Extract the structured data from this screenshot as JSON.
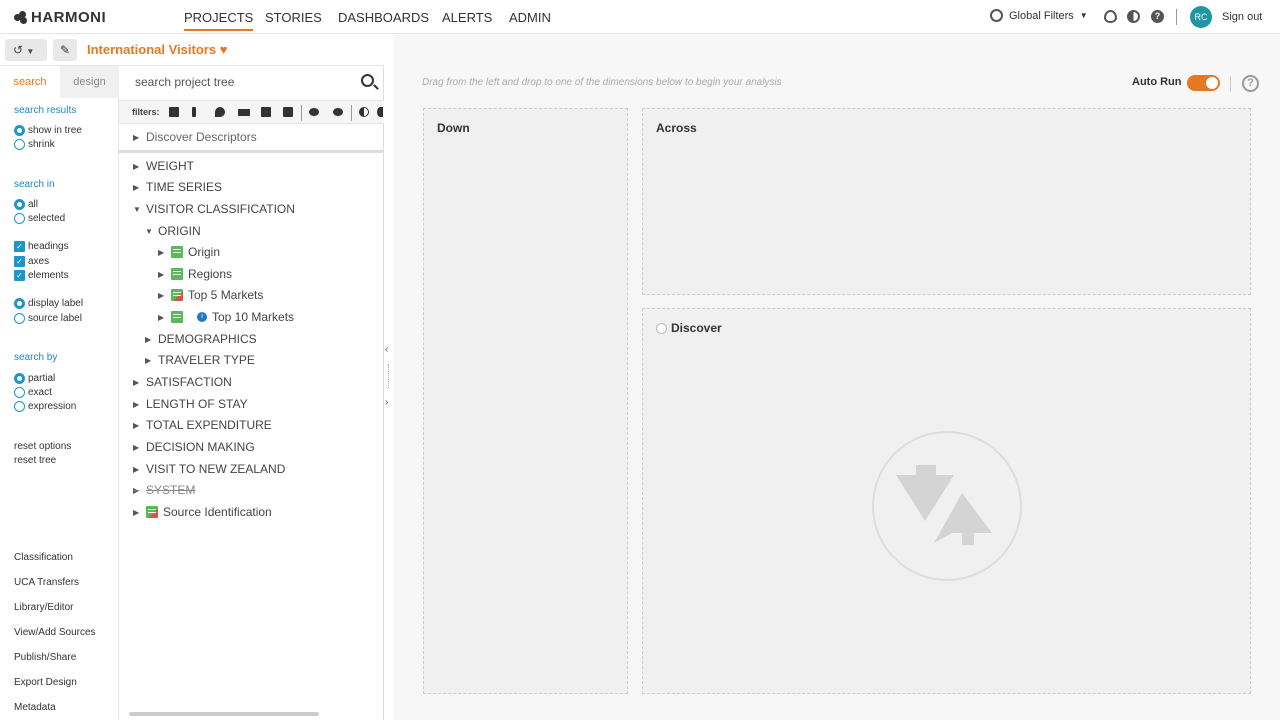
{
  "app": {
    "brand": "HARMONI"
  },
  "nav": {
    "items": [
      "PROJECTS",
      "STORIES",
      "DASHBOARDS",
      "ALERTS",
      "ADMIN"
    ],
    "active": "PROJECTS"
  },
  "header": {
    "global_filters": "Global Filters",
    "avatar": "RC",
    "sign_out": "Sign out"
  },
  "project": {
    "title": "International Visitors"
  },
  "side": {
    "tabs": {
      "search": "search",
      "design": "design"
    },
    "search_results": {
      "heading": "search results",
      "options": [
        "show in tree",
        "shrink"
      ],
      "selected": "show in tree"
    },
    "search_in": {
      "heading": "search in",
      "scope": [
        "all",
        "selected"
      ],
      "checks": [
        "headings",
        "axes",
        "elements"
      ],
      "labels": [
        "display label",
        "source label"
      ]
    },
    "search_by": {
      "heading": "search by",
      "options": [
        "partial",
        "exact",
        "expression"
      ]
    },
    "resets": [
      "reset options",
      "reset tree"
    ],
    "links": [
      "Classification",
      "UCA Transfers",
      "Library/Editor",
      "View/Add Sources",
      "Publish/Share",
      "Export Design",
      "Metadata"
    ]
  },
  "tree": {
    "search_placeholder": "search project tree",
    "filters_label": "filters:",
    "header_row": "Discover Descriptors",
    "rows": [
      {
        "label": "WEIGHT"
      },
      {
        "label": "TIME SERIES"
      },
      {
        "label": "VISITOR CLASSIFICATION"
      },
      {
        "label": "ORIGIN"
      },
      {
        "label": "Origin"
      },
      {
        "label": "Regions"
      },
      {
        "label": "Top 5 Markets"
      },
      {
        "label": "Top 10 Markets"
      },
      {
        "label": "DEMOGRAPHICS"
      },
      {
        "label": "TRAVELER TYPE"
      },
      {
        "label": "SATISFACTION"
      },
      {
        "label": "LENGTH OF STAY"
      },
      {
        "label": "TOTAL EXPENDITURE"
      },
      {
        "label": "DECISION MAKING"
      },
      {
        "label": "VISIT TO NEW ZEALAND"
      },
      {
        "label": "SYSTEM"
      },
      {
        "label": "Source Identification"
      }
    ]
  },
  "canvas": {
    "hint": "Drag from the left and drop to one of the dimensions below to begin your analysis",
    "auto_run": "Auto Run",
    "zones": {
      "down": "Down",
      "across": "Across",
      "discover": "Discover"
    }
  },
  "colors": {
    "accent": "#e87722",
    "blue": "#1e96c8",
    "green": "#5cb85c"
  }
}
